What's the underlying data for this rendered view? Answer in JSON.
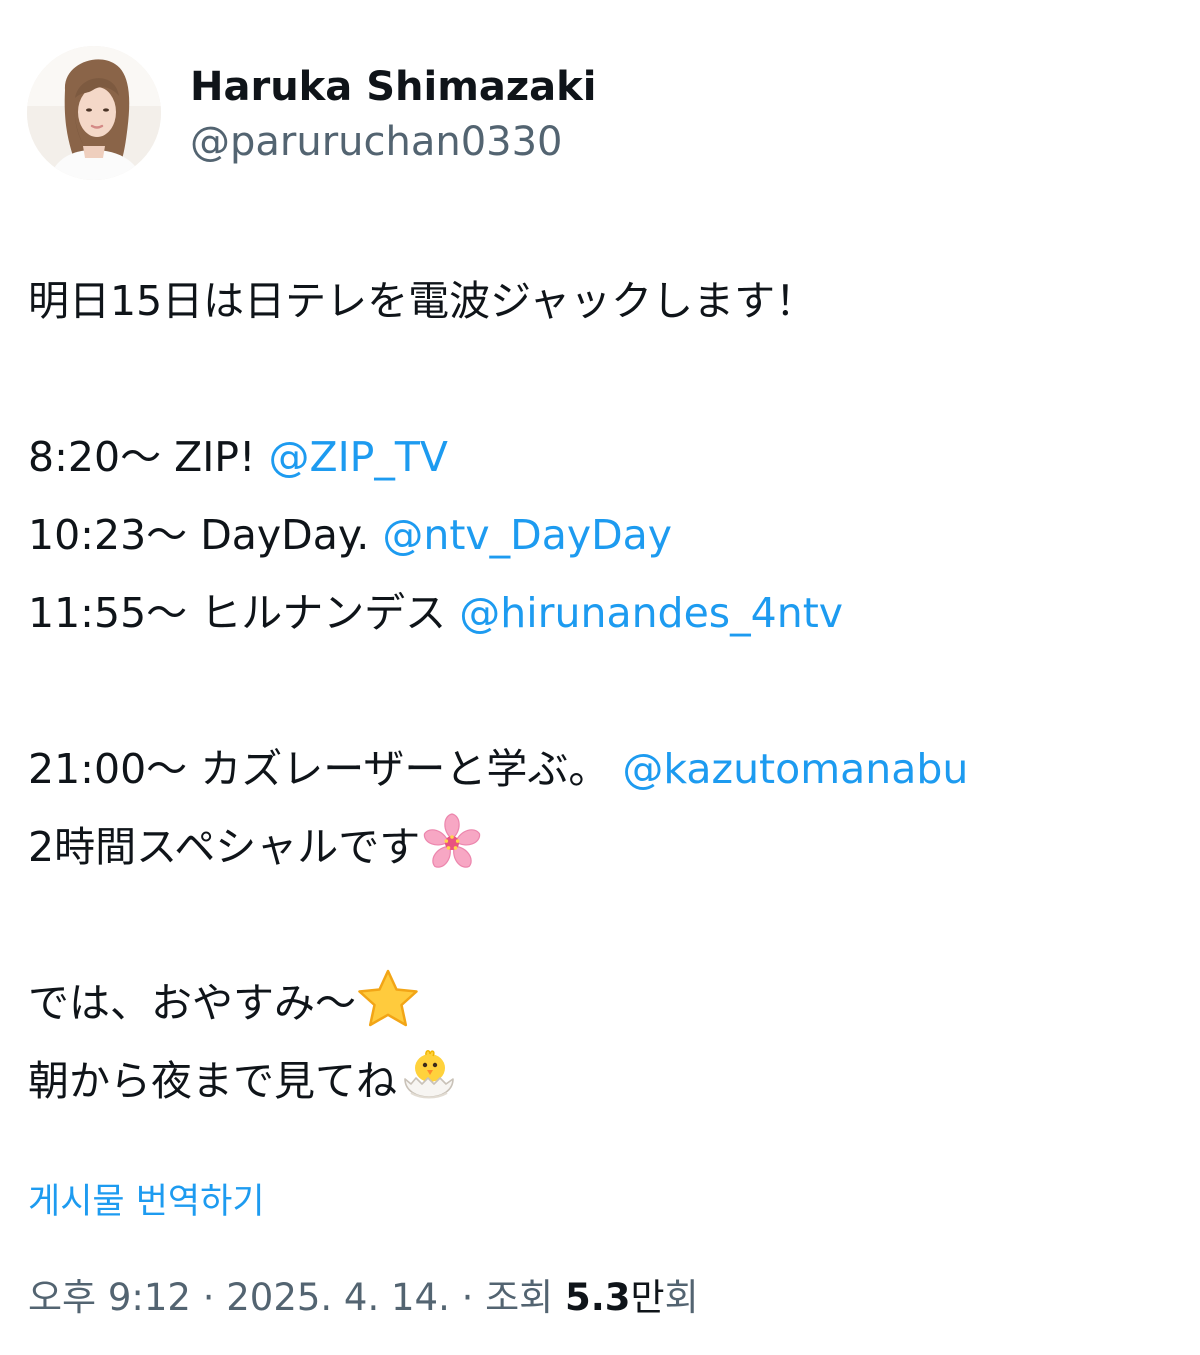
{
  "user": {
    "display_name": "Haruka Shimazaki",
    "handle": "@paruruchan0330",
    "avatar_icon": "profile-photo"
  },
  "tweet": {
    "line1": "明日15日は日テレを電波ジャックします！",
    "program1": {
      "time": "8:20～ ZIP! ",
      "mention": "@ZIP_TV"
    },
    "program2": {
      "time": "10:23～ DayDay. ",
      "mention": "@ntv_DayDay"
    },
    "program3": {
      "time": "11:55～ ヒルナンデス ",
      "mention": "@hirunandes_4ntv"
    },
    "program4": {
      "time": "21:00～ カズレーザーと学ぶ。 ",
      "mention": "@kazutomanabu"
    },
    "special": "2時間スペシャルです",
    "goodnight": "では、おやすみ～",
    "watch": "朝から夜まで見てね",
    "emojis": [
      "cherry-blossom",
      "star",
      "hatching-chick"
    ]
  },
  "translate_label": "게시물 번역하기",
  "meta": {
    "time": "오후 9:12",
    "sep1": " · ",
    "date": "2025. 4. 14.",
    "sep2": " · ",
    "views_label": "조회 ",
    "views_count": "5.3",
    "views_unit_a": "만",
    "views_unit_b": "회"
  },
  "colors": {
    "text": "#0f1419",
    "secondary": "#536471",
    "link": "#1d9bf0"
  }
}
